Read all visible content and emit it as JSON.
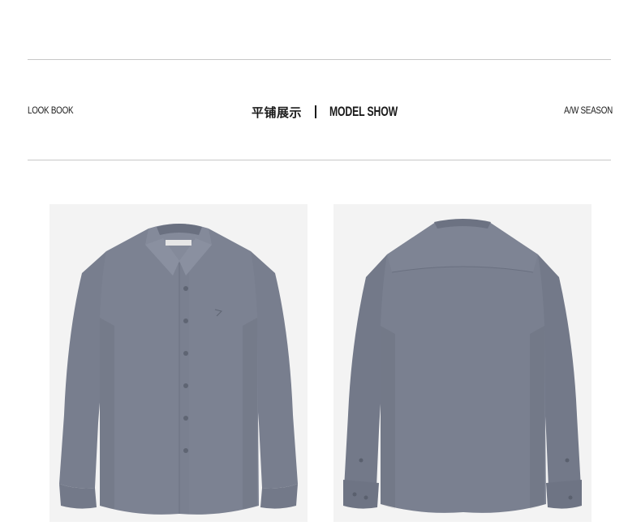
{
  "header": {
    "left_label": "LOOK BOOK",
    "center_cn": "平铺展示",
    "center_en": "MODEL SHOW",
    "right_label": "A/W SEASON"
  },
  "colors": {
    "shirt": "#7a8090",
    "shirt_dark": "#5f6573",
    "photo_bg": "#f3f3f3",
    "rule": "#c8c8c8"
  },
  "images": [
    {
      "name": "shirt-front",
      "view": "front"
    },
    {
      "name": "shirt-back",
      "view": "back"
    }
  ]
}
